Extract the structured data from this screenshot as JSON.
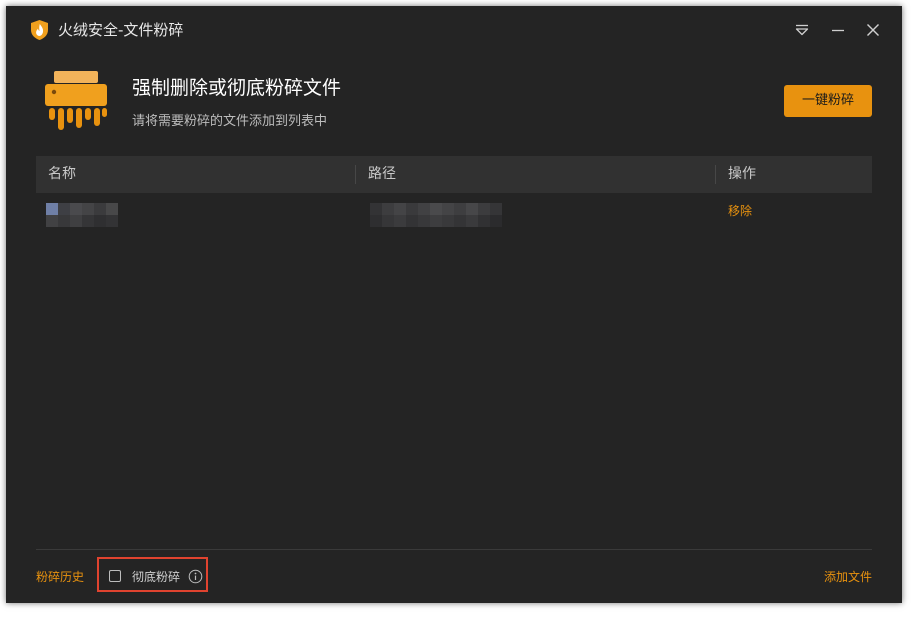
{
  "window": {
    "title": "火绒安全-文件粉碎",
    "controls": [
      "menu-icon",
      "minimize-icon",
      "close-icon"
    ]
  },
  "header": {
    "heading": "强制删除或彻底粉碎文件",
    "subheading": "请将需要粉碎的文件添加到列表中",
    "shred_button": "一键粉碎"
  },
  "table": {
    "columns": [
      "名称",
      "路径",
      "操作"
    ],
    "rows": [
      {
        "name": "",
        "path": "",
        "action": "移除"
      }
    ]
  },
  "footer": {
    "history_link": "粉碎历史",
    "thorough_label": "彻底粉碎",
    "thorough_checked": false,
    "add_file_link": "添加文件"
  },
  "colors": {
    "accent": "#e8920f",
    "background": "#242424",
    "table_header": "#313131",
    "highlight": "#e0432f"
  }
}
